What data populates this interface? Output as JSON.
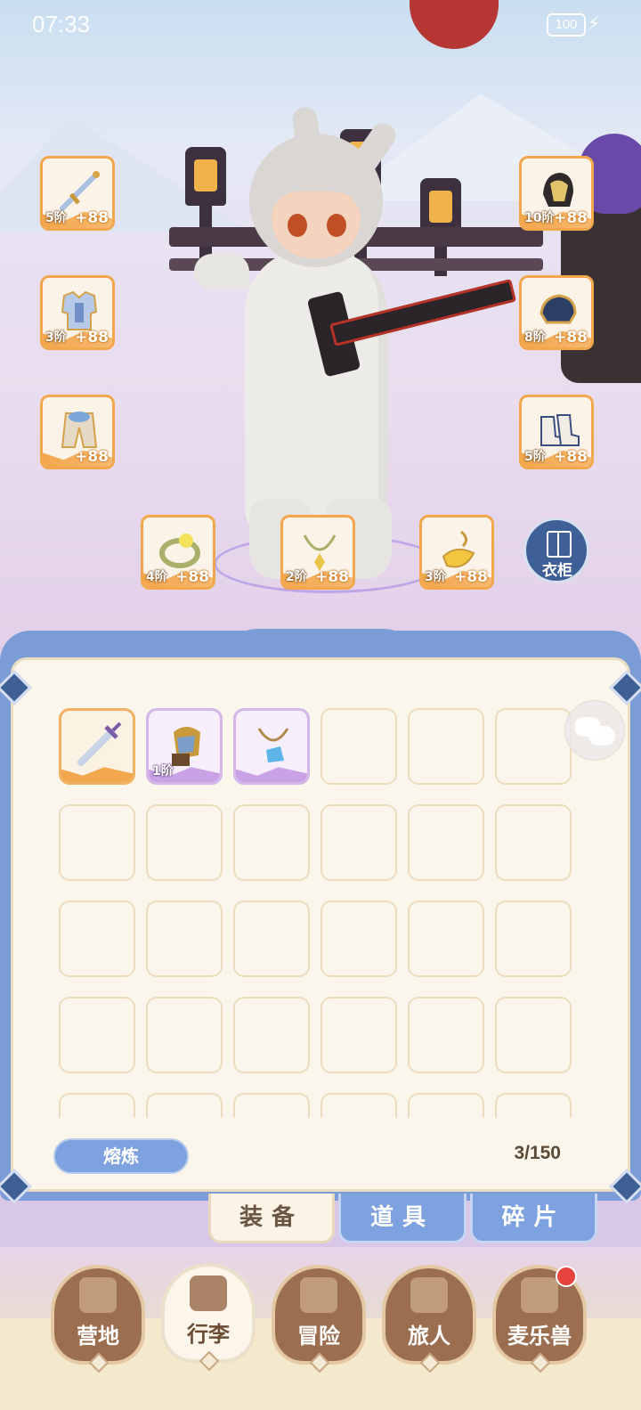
{
  "status_bar": {
    "time": "07:33",
    "battery": "100"
  },
  "colors": {
    "accent_blue": "#7ea1df",
    "orange_rarity": "#f3a74c",
    "purple_rarity": "#c9a2e6",
    "nav_brown": "#9c6e50"
  },
  "equipment": {
    "weapon": {
      "icon": "sword-icon",
      "tier": "5阶",
      "bonus": "+88"
    },
    "helmet": {
      "icon": "helmet-icon",
      "tier": "10阶",
      "bonus": "+88"
    },
    "armor": {
      "icon": "armor-icon",
      "tier": "3阶",
      "bonus": "+88"
    },
    "gloves": {
      "icon": "gloves-icon",
      "tier": "8阶",
      "bonus": "+88"
    },
    "pants": {
      "icon": "pants-icon",
      "tier": "",
      "bonus": "+88"
    },
    "boots": {
      "icon": "boots-icon",
      "tier": "5阶",
      "bonus": "+88"
    },
    "ring": {
      "icon": "ring-icon",
      "tier": "4阶",
      "bonus": "+88"
    },
    "necklace": {
      "icon": "necklace-icon",
      "tier": "2阶",
      "bonus": "+88"
    },
    "charm": {
      "icon": "charm-icon",
      "tier": "3阶",
      "bonus": "+88"
    }
  },
  "wardrobe": {
    "label": "衣柜",
    "icon": "wardrobe-icon"
  },
  "inventory": {
    "items": [
      {
        "icon": "sword-icon",
        "rarity": "orange",
        "tier": ""
      },
      {
        "icon": "gauntlet-icon",
        "rarity": "purple",
        "tier": "1阶"
      },
      {
        "icon": "pendant-icon",
        "rarity": "purple",
        "tier": ""
      }
    ],
    "smelt_button": "熔炼",
    "count": "3/150"
  },
  "tabs": [
    "装备",
    "道具",
    "碎片"
  ],
  "nav": [
    {
      "label": "营地",
      "icon": "castle-icon"
    },
    {
      "label": "行李",
      "icon": "backpack-icon"
    },
    {
      "label": "冒险",
      "icon": "crossed-swords-icon"
    },
    {
      "label": "旅人",
      "icon": "traveler-icon"
    },
    {
      "label": "麦乐兽",
      "icon": "cat-icon"
    }
  ]
}
